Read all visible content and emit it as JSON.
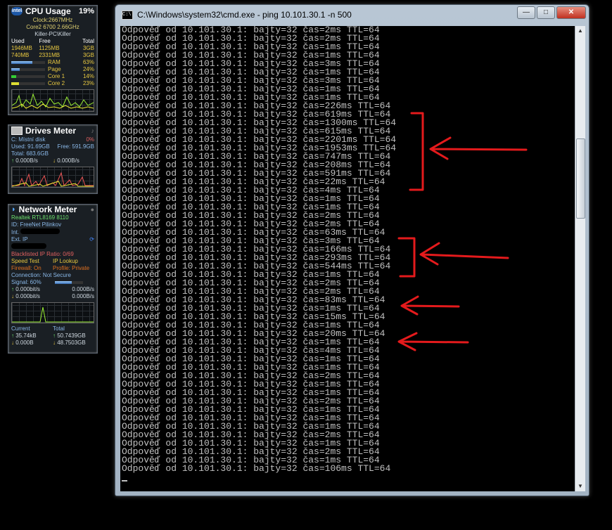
{
  "cpu_gadget": {
    "title": "CPU Usage",
    "percent": "19%",
    "clock": "Clock:2667MHz",
    "cpu_model": "Core2 6700 2.66GHz",
    "machine": "Killer-PC\\Killer",
    "headers": [
      "Used",
      "Free",
      "Total"
    ],
    "rows": [
      [
        "1946MB",
        "1125MB",
        "3GB"
      ],
      [
        "740MB",
        "2331MB",
        "3GB"
      ]
    ],
    "bars": [
      {
        "label": "RAM",
        "value": "63%",
        "fill": 0.63
      },
      {
        "label": "Page",
        "value": "24%",
        "fill": 0.24
      },
      {
        "label": "Core 1",
        "value": "14%",
        "fill": 0.14
      },
      {
        "label": "Core 2",
        "value": "23%",
        "fill": 0.23
      }
    ],
    "logo_text": "intel"
  },
  "drives_gadget": {
    "title": "Drives Meter",
    "drive": "C: Místní disk",
    "drive_pct": "0%",
    "used": "Used: 91.69GB",
    "free": "Free: 591.9GB",
    "total": "Total: 683.6GB",
    "read": "0.000B/s",
    "write": "0.000B/s"
  },
  "network_gadget": {
    "title": "Network Meter",
    "adapter": "Realtek RTL8169 8110",
    "id": "ID: FreeNet Pilinkov",
    "int_label": "Int.",
    "ext_label": "Ext. IP",
    "blacklist": "Blacklisted IP Ratio: 0/69",
    "speed_test": "Speed Test",
    "ip_lookup": "IP Lookup",
    "firewall": "Firewall: On",
    "profile": "Profile: Private",
    "connection": "Connection: Not Secure",
    "signal": "Signal: 60%",
    "signal_fill": 0.6,
    "up_rate": "0.000bit/s",
    "up_bytes": "0.000B/s",
    "down_rate": "0.000bit/s",
    "down_bytes": "0.000B/s",
    "current_label": "Current",
    "total_label": "Total",
    "current_up": "35.74kB",
    "current_down": "0.000B",
    "total_up": "50.7439GB",
    "total_down": "48.7503GB"
  },
  "cmd_window": {
    "title": "C:\\Windows\\system32\\cmd.exe - ping  10.101.30.1 -n 500",
    "icon_text": "C:\\",
    "controls": {
      "minimize": "—",
      "maximize": "□",
      "close": "✕"
    },
    "line_prefix": "Odpověď od 10.101.30.1: bajty=32 čas=",
    "line_suffix": " TTL=64",
    "times": [
      "2ms",
      "2ms",
      "1ms",
      "1ms",
      "3ms",
      "1ms",
      "3ms",
      "1ms",
      "1ms",
      "226ms",
      "619ms",
      "1300ms",
      "615ms",
      "2201ms",
      "1953ms",
      "747ms",
      "208ms",
      "591ms",
      "22ms",
      "4ms",
      "1ms",
      "1ms",
      "2ms",
      "2ms",
      "63ms",
      "3ms",
      "166ms",
      "293ms",
      "544ms",
      "1ms",
      "2ms",
      "2ms",
      "83ms",
      "1ms",
      "15ms",
      "1ms",
      "20ms",
      "1ms",
      "4ms",
      "1ms",
      "1ms",
      "2ms",
      "1ms",
      "1ms",
      "2ms",
      "1ms",
      "1ms",
      "1ms",
      "2ms",
      "1ms",
      "2ms",
      "1ms",
      "106ms"
    ]
  },
  "colors": {
    "console_bg": "#000000",
    "console_text": "#c0c0c0",
    "annotation": "#e41a1c"
  }
}
